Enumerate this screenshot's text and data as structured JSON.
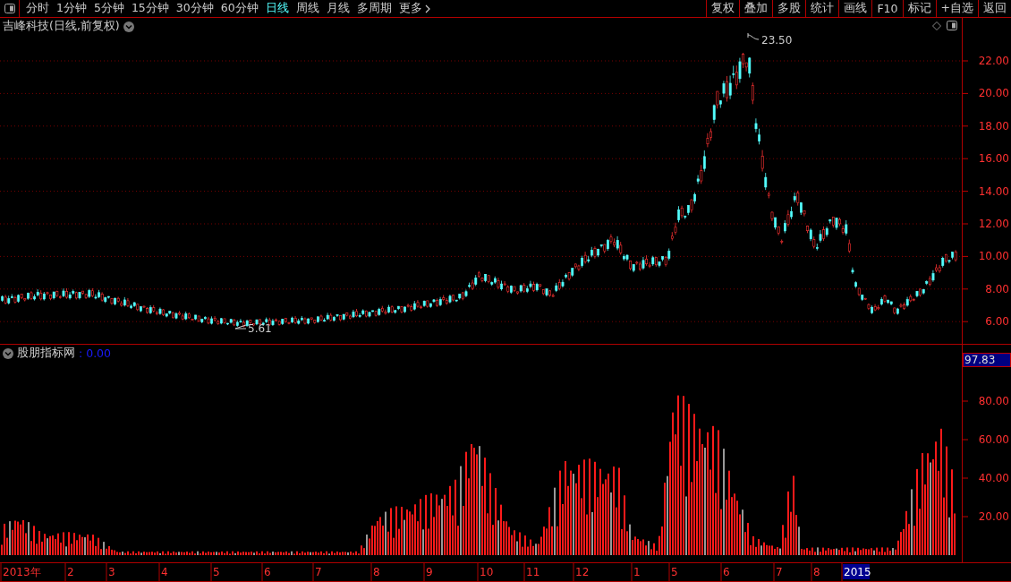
{
  "toolbar": {
    "periods": [
      {
        "label": "分时",
        "selected": false
      },
      {
        "label": "1分钟",
        "selected": false
      },
      {
        "label": "5分钟",
        "selected": false
      },
      {
        "label": "15分钟",
        "selected": false
      },
      {
        "label": "30分钟",
        "selected": false
      },
      {
        "label": "60分钟",
        "selected": false
      },
      {
        "label": "日线",
        "selected": true
      },
      {
        "label": "周线",
        "selected": false
      },
      {
        "label": "月线",
        "selected": false
      },
      {
        "label": "多周期",
        "selected": false
      },
      {
        "label": "更多",
        "selected": false
      }
    ],
    "buttons": [
      "复权",
      "叠加",
      "多股",
      "统计",
      "画线",
      "F10",
      "标记",
      "+自选",
      "返回"
    ]
  },
  "price_chart": {
    "title": "吉峰科技(日线,前复权)",
    "y_ticks": [
      "22.00",
      "20.00",
      "18.00",
      "16.00",
      "14.00",
      "12.00",
      "10.00",
      "8.00",
      "6.00"
    ],
    "high_label": "23.50",
    "low_label": "5.61"
  },
  "indicator": {
    "name": "股朋指标网",
    "value": ": 0.00",
    "current_value": "97.83",
    "y_ticks": [
      "80.00",
      "60.00",
      "40.00",
      "20.00"
    ]
  },
  "time_axis": [
    {
      "label": "2013年",
      "highlighted": false
    },
    {
      "label": "2",
      "highlighted": false
    },
    {
      "label": "3",
      "highlighted": false
    },
    {
      "label": "4",
      "highlighted": false
    },
    {
      "label": "5",
      "highlighted": false
    },
    {
      "label": "6",
      "highlighted": false
    },
    {
      "label": "7",
      "highlighted": false
    },
    {
      "label": "8",
      "highlighted": false
    },
    {
      "label": "9",
      "highlighted": false
    },
    {
      "label": "10",
      "highlighted": false
    },
    {
      "label": "11",
      "highlighted": false
    },
    {
      "label": "12",
      "highlighted": false
    },
    {
      "label": "1",
      "highlighted": false
    },
    {
      "label": "5",
      "highlighted": false
    },
    {
      "label": "6",
      "highlighted": false
    },
    {
      "label": "7",
      "highlighted": false
    },
    {
      "label": "8",
      "highlighted": false
    },
    {
      "label": "2015",
      "highlighted": true
    }
  ]
}
